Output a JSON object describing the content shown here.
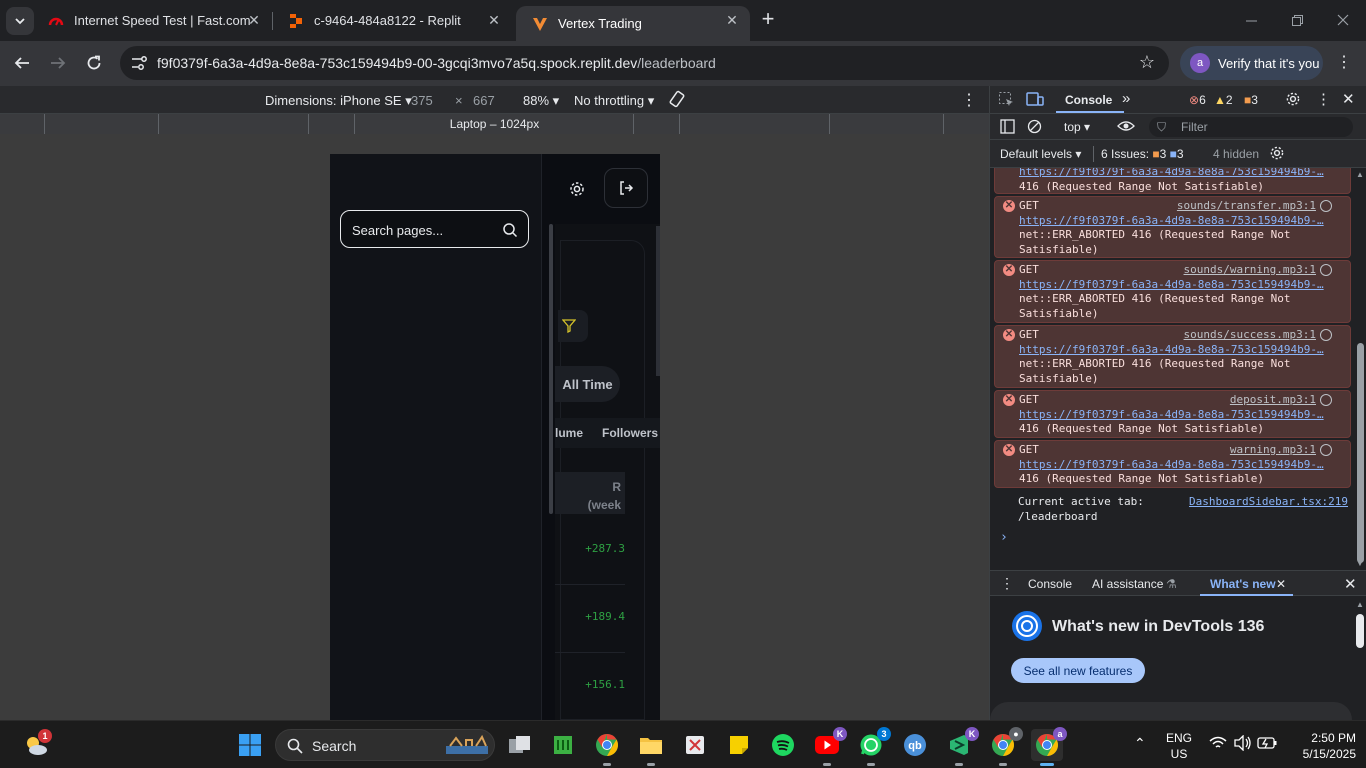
{
  "browser": {
    "tabs": [
      {
        "title": "Internet Speed Test | Fast.com",
        "active": false
      },
      {
        "title": "c-9464-484a8122 - Replit",
        "active": false
      },
      {
        "title": "Vertex Trading",
        "active": true
      }
    ],
    "url_host": "f9f0379f-6a3a-4d9a-8e8a-753c159494b9-00-3gcqi3mvo7a5q.spock.replit.dev",
    "url_path": "/leaderboard",
    "verify_label": "Verify that it's you",
    "profile_initial": "a"
  },
  "device_toolbar": {
    "dimensions_label": "Dimensions: iPhone SE",
    "width": "375",
    "height": "667",
    "zoom": "88%",
    "throttling": "No throttling",
    "media_label": "Laptop – 1024px"
  },
  "app": {
    "search_placeholder": "Search pages...",
    "filter_all_time": "All Time",
    "col_volume": "lume",
    "col_followers": "Followers",
    "col_r_line1": "R",
    "col_r_line2": "(week",
    "pnl_values": [
      "+287.3",
      "+189.4",
      "+156.1"
    ]
  },
  "devtools": {
    "tab_console": "Console",
    "error_count": "6",
    "warning_count": "2",
    "issue_count": "3",
    "context": "top",
    "filter_placeholder": "Filter",
    "levels": "Default levels",
    "issues_label": "6 Issues:",
    "issues_warn": "3",
    "issues_info": "3",
    "hidden": "4 hidden",
    "log": {
      "top_partial": {
        "url": "https://f9f0379f-6a3a-4d9a-8e8a-753c159494b9-…",
        "msg": "416 (Requested Range Not Satisfiable)"
      },
      "errors": [
        {
          "method": "GET",
          "source": "sounds/transfer.mp3:1",
          "url": "https://f9f0379f-6a3a-4d9a-8e8a-753c159494b9-…",
          "msg1": "net::ERR_ABORTED 416 (Requested Range Not",
          "msg2": "Satisfiable)"
        },
        {
          "method": "GET",
          "source": "sounds/warning.mp3:1",
          "url": "https://f9f0379f-6a3a-4d9a-8e8a-753c159494b9-…",
          "msg1": "net::ERR_ABORTED 416 (Requested Range Not",
          "msg2": "Satisfiable)"
        },
        {
          "method": "GET",
          "source": "sounds/success.mp3:1",
          "url": "https://f9f0379f-6a3a-4d9a-8e8a-753c159494b9-…",
          "msg1": "net::ERR_ABORTED 416 (Requested Range Not",
          "msg2": "Satisfiable)"
        },
        {
          "method": "GET",
          "source": "deposit.mp3:1",
          "url": "https://f9f0379f-6a3a-4d9a-8e8a-753c159494b9-…",
          "msg1": "416 (Requested Range Not Satisfiable)"
        },
        {
          "method": "GET",
          "source": "warning.mp3:1",
          "url": "https://f9f0379f-6a3a-4d9a-8e8a-753c159494b9-…",
          "msg1": "416 (Requested Range Not Satisfiable)"
        }
      ],
      "info": {
        "text": "Current active tab:",
        "source": "DashboardSidebar.tsx:219",
        "value": "/leaderboard"
      }
    },
    "drawer_tabs": [
      "Console",
      "AI assistance",
      "What's new"
    ],
    "whats_new_title": "What's new in DevTools 136",
    "whats_new_button": "See all new features"
  },
  "taskbar": {
    "weather_badge": "1",
    "search_label": "Search",
    "whatsapp_badge": "3",
    "lang": "ENG",
    "region": "US",
    "time": "2:50 PM",
    "date": "5/15/2025",
    "colors": {
      "accent": "#0078d4"
    }
  }
}
